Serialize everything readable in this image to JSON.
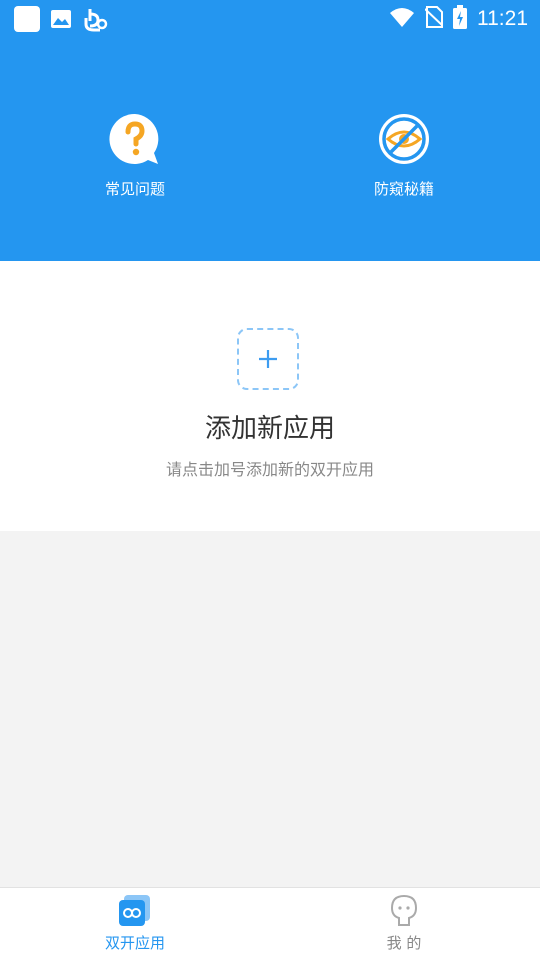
{
  "status_bar": {
    "time": "11:21"
  },
  "header": {
    "items": [
      {
        "label": "常见问题",
        "icon": "question-bubble-icon"
      },
      {
        "label": "防窥秘籍",
        "icon": "anti-peek-eye-icon"
      }
    ],
    "background": "#2496f0"
  },
  "add_card": {
    "title": "添加新应用",
    "subtitle": "请点击加号添加新的双开应用"
  },
  "tabs": [
    {
      "label": "双开应用",
      "active": true,
      "color": "#2496f0"
    },
    {
      "label": "我 的",
      "active": false,
      "color": "#888888"
    }
  ],
  "colors": {
    "accent": "#2496f0",
    "orange": "#f5a623"
  }
}
